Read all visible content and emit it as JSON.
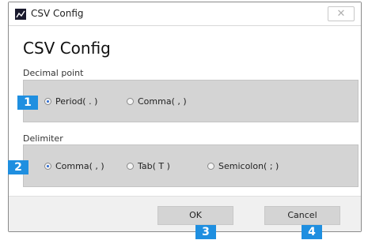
{
  "window": {
    "title": "CSV Config",
    "close_label": "✕",
    "app_icon": "csv-app-icon"
  },
  "heading": "CSV Config",
  "decimal_point": {
    "label": "Decimal point",
    "options": [
      {
        "label": "Period( . )",
        "checked": true
      },
      {
        "label": "Comma( , )",
        "checked": false
      }
    ]
  },
  "delimiter": {
    "label": "Delimiter",
    "options": [
      {
        "label": "Comma( , )",
        "checked": true
      },
      {
        "label": "Tab( T )",
        "checked": false
      },
      {
        "label": "Semicolon( ; )",
        "checked": false
      }
    ]
  },
  "buttons": {
    "ok": "OK",
    "cancel": "Cancel"
  },
  "badges": [
    "1",
    "2",
    "3",
    "4"
  ],
  "colors": {
    "badge": "#1f8fe0",
    "group_background": "#d4d4d4",
    "radio_checked": "#2d6bd0"
  }
}
